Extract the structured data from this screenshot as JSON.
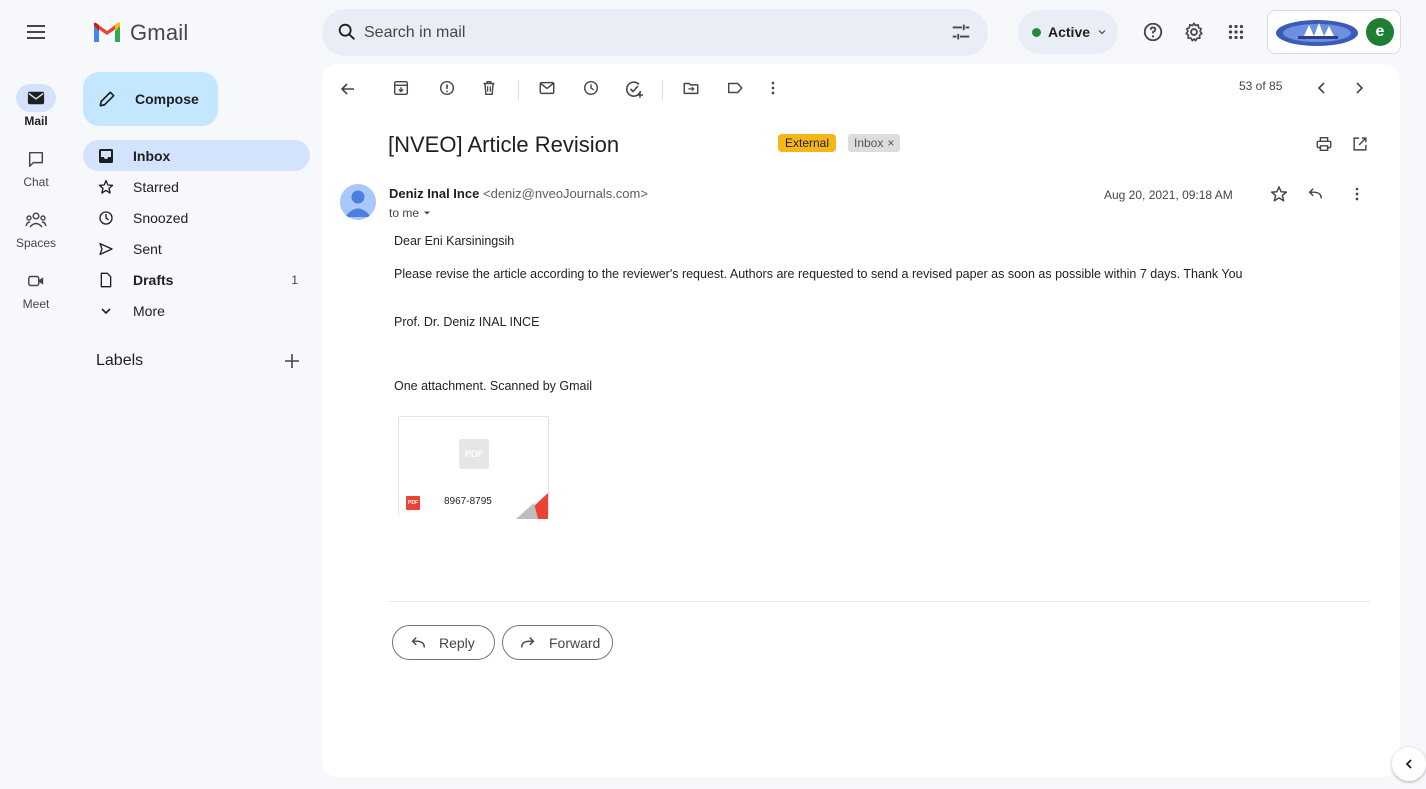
{
  "app": {
    "name": "Gmail"
  },
  "search": {
    "placeholder": "Search in mail"
  },
  "status": {
    "label": "Active"
  },
  "account": {
    "avatar_initial": "e"
  },
  "rail": {
    "items": [
      {
        "label": "Mail",
        "icon": "mail-icon",
        "active": true
      },
      {
        "label": "Chat",
        "icon": "chat-icon",
        "active": false
      },
      {
        "label": "Spaces",
        "icon": "spaces-icon",
        "active": false
      },
      {
        "label": "Meet",
        "icon": "meet-icon",
        "active": false
      }
    ]
  },
  "sidebar": {
    "compose_label": "Compose",
    "items": [
      {
        "label": "Inbox",
        "icon": "inbox-icon",
        "count": "",
        "active": true
      },
      {
        "label": "Starred",
        "icon": "star-icon",
        "count": ""
      },
      {
        "label": "Snoozed",
        "icon": "clock-icon",
        "count": ""
      },
      {
        "label": "Sent",
        "icon": "send-icon",
        "count": ""
      },
      {
        "label": "Drafts",
        "icon": "draft-icon",
        "count": "1"
      },
      {
        "label": "More",
        "icon": "chevron-down-icon",
        "count": ""
      }
    ],
    "labels_heading": "Labels"
  },
  "toolbar": {
    "icons": [
      "back-icon",
      "archive-icon",
      "report-spam-icon",
      "delete-icon",
      "mark-unread-icon",
      "snooze-icon",
      "add-task-icon",
      "move-to-icon",
      "label-icon",
      "more-vert-icon"
    ],
    "counter": "53 of 85"
  },
  "email": {
    "subject": "[NVEO] Article Revision",
    "tags": {
      "external": "External",
      "inbox": "Inbox"
    },
    "sender_name": "Deniz Inal Ince",
    "sender_email": "<deniz@nveoJournals.com>",
    "to": "to me",
    "date": "Aug 20, 2021, 09:18 AM",
    "body": {
      "greeting": "Dear Eni Karsiningsih",
      "paragraph": "Please revise the article according to the reviewer's request. Authors are requested to send a revised paper as soon as possible within 7 days. Thank You",
      "signature": "Prof. Dr. Deniz INAL INCE"
    },
    "attachments_summary": "One attachment. Scanned by Gmail",
    "attachment": {
      "name": "8967-8795",
      "type_badge": "PDF"
    }
  },
  "actions": {
    "reply": "Reply",
    "forward": "Forward"
  },
  "colors": {
    "background": "#f6f8fc",
    "compose": "#c2e7ff",
    "active_nav": "#d3e3fd",
    "external_tag": "#f6b617",
    "status_green": "#1e8e3e",
    "pdf_red": "#ea4335"
  }
}
